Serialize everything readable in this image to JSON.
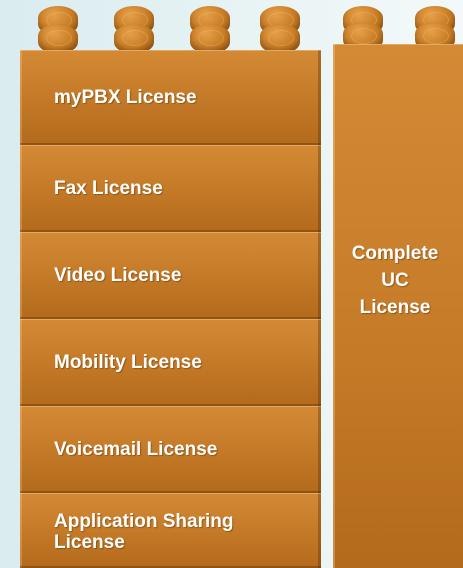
{
  "licenses": {
    "mypbx": "myPBX License",
    "fax": "Fax License",
    "video": "Video License",
    "mobility": "Mobility License",
    "voicemail": "Voicemail License",
    "app_sharing_line1": "Application Sharing",
    "app_sharing_line2": "License"
  },
  "complete": {
    "line1": "Complete",
    "line2": "UC",
    "line3": "License"
  },
  "colors": {
    "brick": "#c47a27",
    "background": "#e3f1f3",
    "text": "#ffffff"
  }
}
